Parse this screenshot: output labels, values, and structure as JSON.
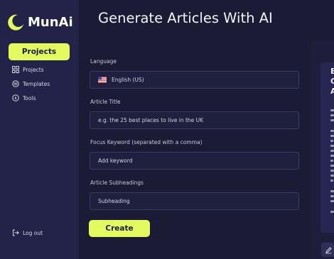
{
  "brand": {
    "name": "MunAi"
  },
  "sidebar": {
    "primary_button": "Projects",
    "items": [
      {
        "label": "Projects",
        "icon": "grid-icon"
      },
      {
        "label": "Templates",
        "icon": "template-icon"
      },
      {
        "label": "Tools",
        "icon": "compass-icon"
      }
    ],
    "logout": {
      "label": "Log out",
      "icon": "logout-icon"
    }
  },
  "header": {
    "title": "Generate Articles With AI"
  },
  "form": {
    "language": {
      "label": "Language",
      "value": "English (US)",
      "flag": "us-flag-icon"
    },
    "title": {
      "label": "Article Title",
      "placeholder": "e.g. the 25 best places to live in the UK"
    },
    "keyword": {
      "label": "Focus Keyword (separated with a comma)",
      "placeholder": "Add keyword"
    },
    "subheadings": {
      "label": "Article Subheadings",
      "placeholder": "Subheading"
    },
    "create_label": "Create"
  },
  "right_panel": {
    "heading_letters": [
      "E",
      "C",
      "A"
    ],
    "pen_icon": "pen-icon"
  },
  "colors": {
    "accent": "#e4fb5f",
    "sidebar_bg": "#23234a",
    "page_bg": "#1b1b36"
  }
}
